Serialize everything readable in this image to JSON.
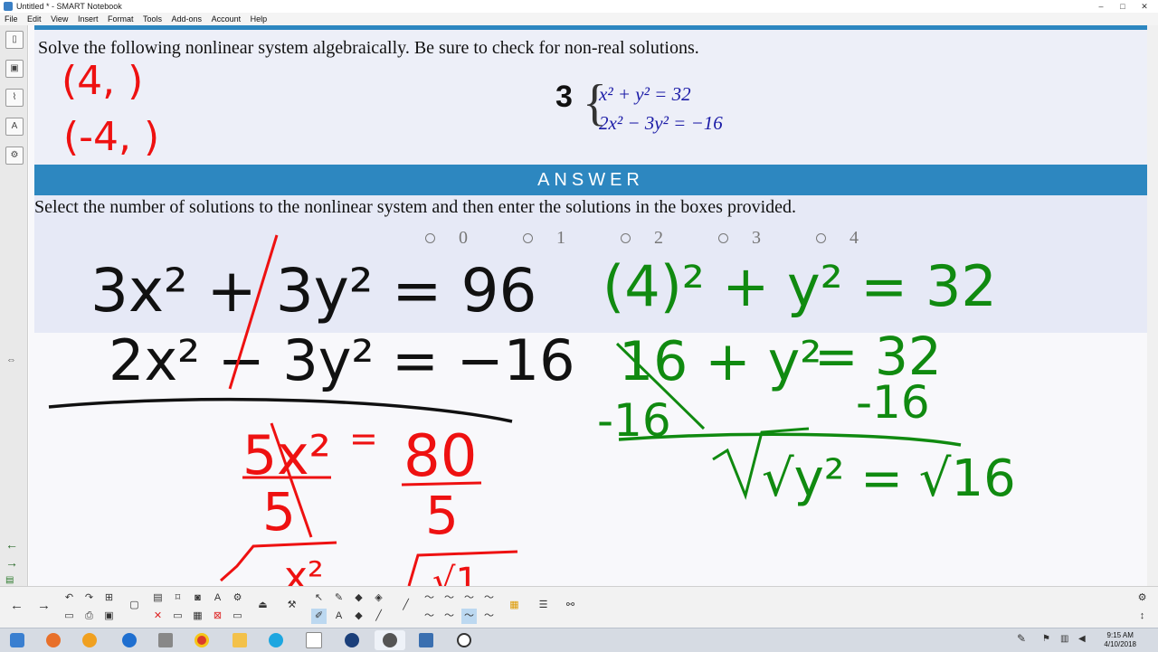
{
  "window": {
    "title": "Untitled * - SMART Notebook",
    "controls": [
      "–",
      "□",
      "✕"
    ]
  },
  "menu": [
    "File",
    "Edit",
    "View",
    "Insert",
    "Format",
    "Tools",
    "Add-ons",
    "Account",
    "Help"
  ],
  "question": "Solve the following nonlinear system algebraically.  Be sure to check for non-real solutions.",
  "problem": {
    "number": "3",
    "eq1": "x² + y² = 32",
    "eq2": "2x² − 3y² = −16"
  },
  "answer_label": "ANSWER",
  "instruction": "Select the number of solutions to the nonlinear system and then enter the solutions in the boxes provided.",
  "choices": [
    "0",
    "1",
    "2",
    "3",
    "4"
  ],
  "ink": {
    "red_pair1": "(4,      )",
    "red_pair2": "(-4,      )",
    "black_line1": "3x² + 3y² = 96",
    "black_line2": "2x² − 3y² = −16",
    "red_step1_lhs": "5x²",
    "red_step1_eq": "=",
    "red_step1_rhs": "80",
    "red_div_left": "5",
    "red_div_right": "5",
    "red_sqrt_left": "x²",
    "red_sqrt_right": "√1",
    "green_line1": "(4)² + y² = 32",
    "green_line2_lhs": "16 + y²",
    "green_line2_rhs": "= 32",
    "green_sub_left": "-16",
    "green_sub_right": "-16",
    "green_sqrt": "√y² = √16"
  },
  "clock": {
    "time": "9:15 AM",
    "date": "4/10/2018"
  },
  "colors": {
    "accent": "#2d87c0",
    "ink_red": "#ee1111",
    "ink_green": "#108a10",
    "ink_black": "#111111",
    "eq_blue": "#1a1aa6"
  }
}
